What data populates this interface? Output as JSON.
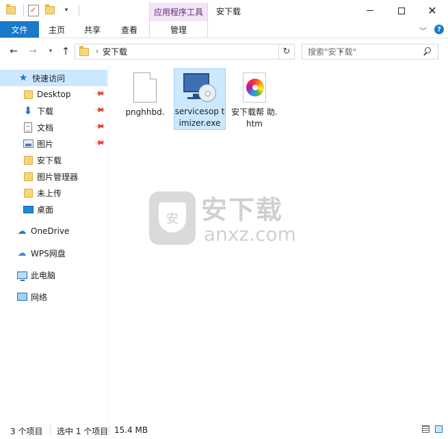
{
  "window": {
    "title": "安下载",
    "context_group": "应用程序工具"
  },
  "ribbon": {
    "tabs": {
      "file": "文件",
      "home": "主页",
      "share": "共享",
      "view": "查看",
      "manage": "管理"
    }
  },
  "address": {
    "path": [
      "安下载"
    ],
    "search_placeholder": "搜索\"安下载\""
  },
  "sidebar": {
    "quick_access": "快速访问",
    "items": [
      {
        "label": "Desktop",
        "icon": "folder-icon",
        "pinned": true
      },
      {
        "label": "下载",
        "icon": "download-arrow-icon",
        "pinned": true
      },
      {
        "label": "文档",
        "icon": "document-icon",
        "pinned": true
      },
      {
        "label": "图片",
        "icon": "picture-icon",
        "pinned": true
      },
      {
        "label": "安下载",
        "icon": "folder-icon",
        "pinned": false
      },
      {
        "label": "图片管理器",
        "icon": "folder-icon",
        "pinned": false
      },
      {
        "label": "未上传",
        "icon": "folder-icon",
        "pinned": false
      },
      {
        "label": "桌面",
        "icon": "desktop-icon",
        "pinned": false
      }
    ],
    "onedrive": "OneDrive",
    "wps": "WPS网盘",
    "this_pc": "此电脑",
    "network": "网络"
  },
  "files": [
    {
      "name": "pnghhbd.",
      "icon": "blank-file-icon",
      "selected": false
    },
    {
      "name": "servicesoptimizer.exe",
      "display": "servicesop timizer.exe",
      "icon": "exe-setup-icon",
      "selected": true
    },
    {
      "name": "安下载帮助.htm",
      "display": "安下载帮 助.htm",
      "icon": "htm-file-icon",
      "selected": false
    }
  ],
  "watermark": {
    "cn": "安下载",
    "en": "anxz.com"
  },
  "status": {
    "count": "3 个项目",
    "selected": "选中 1 个项目",
    "size": "15.4 MB"
  }
}
